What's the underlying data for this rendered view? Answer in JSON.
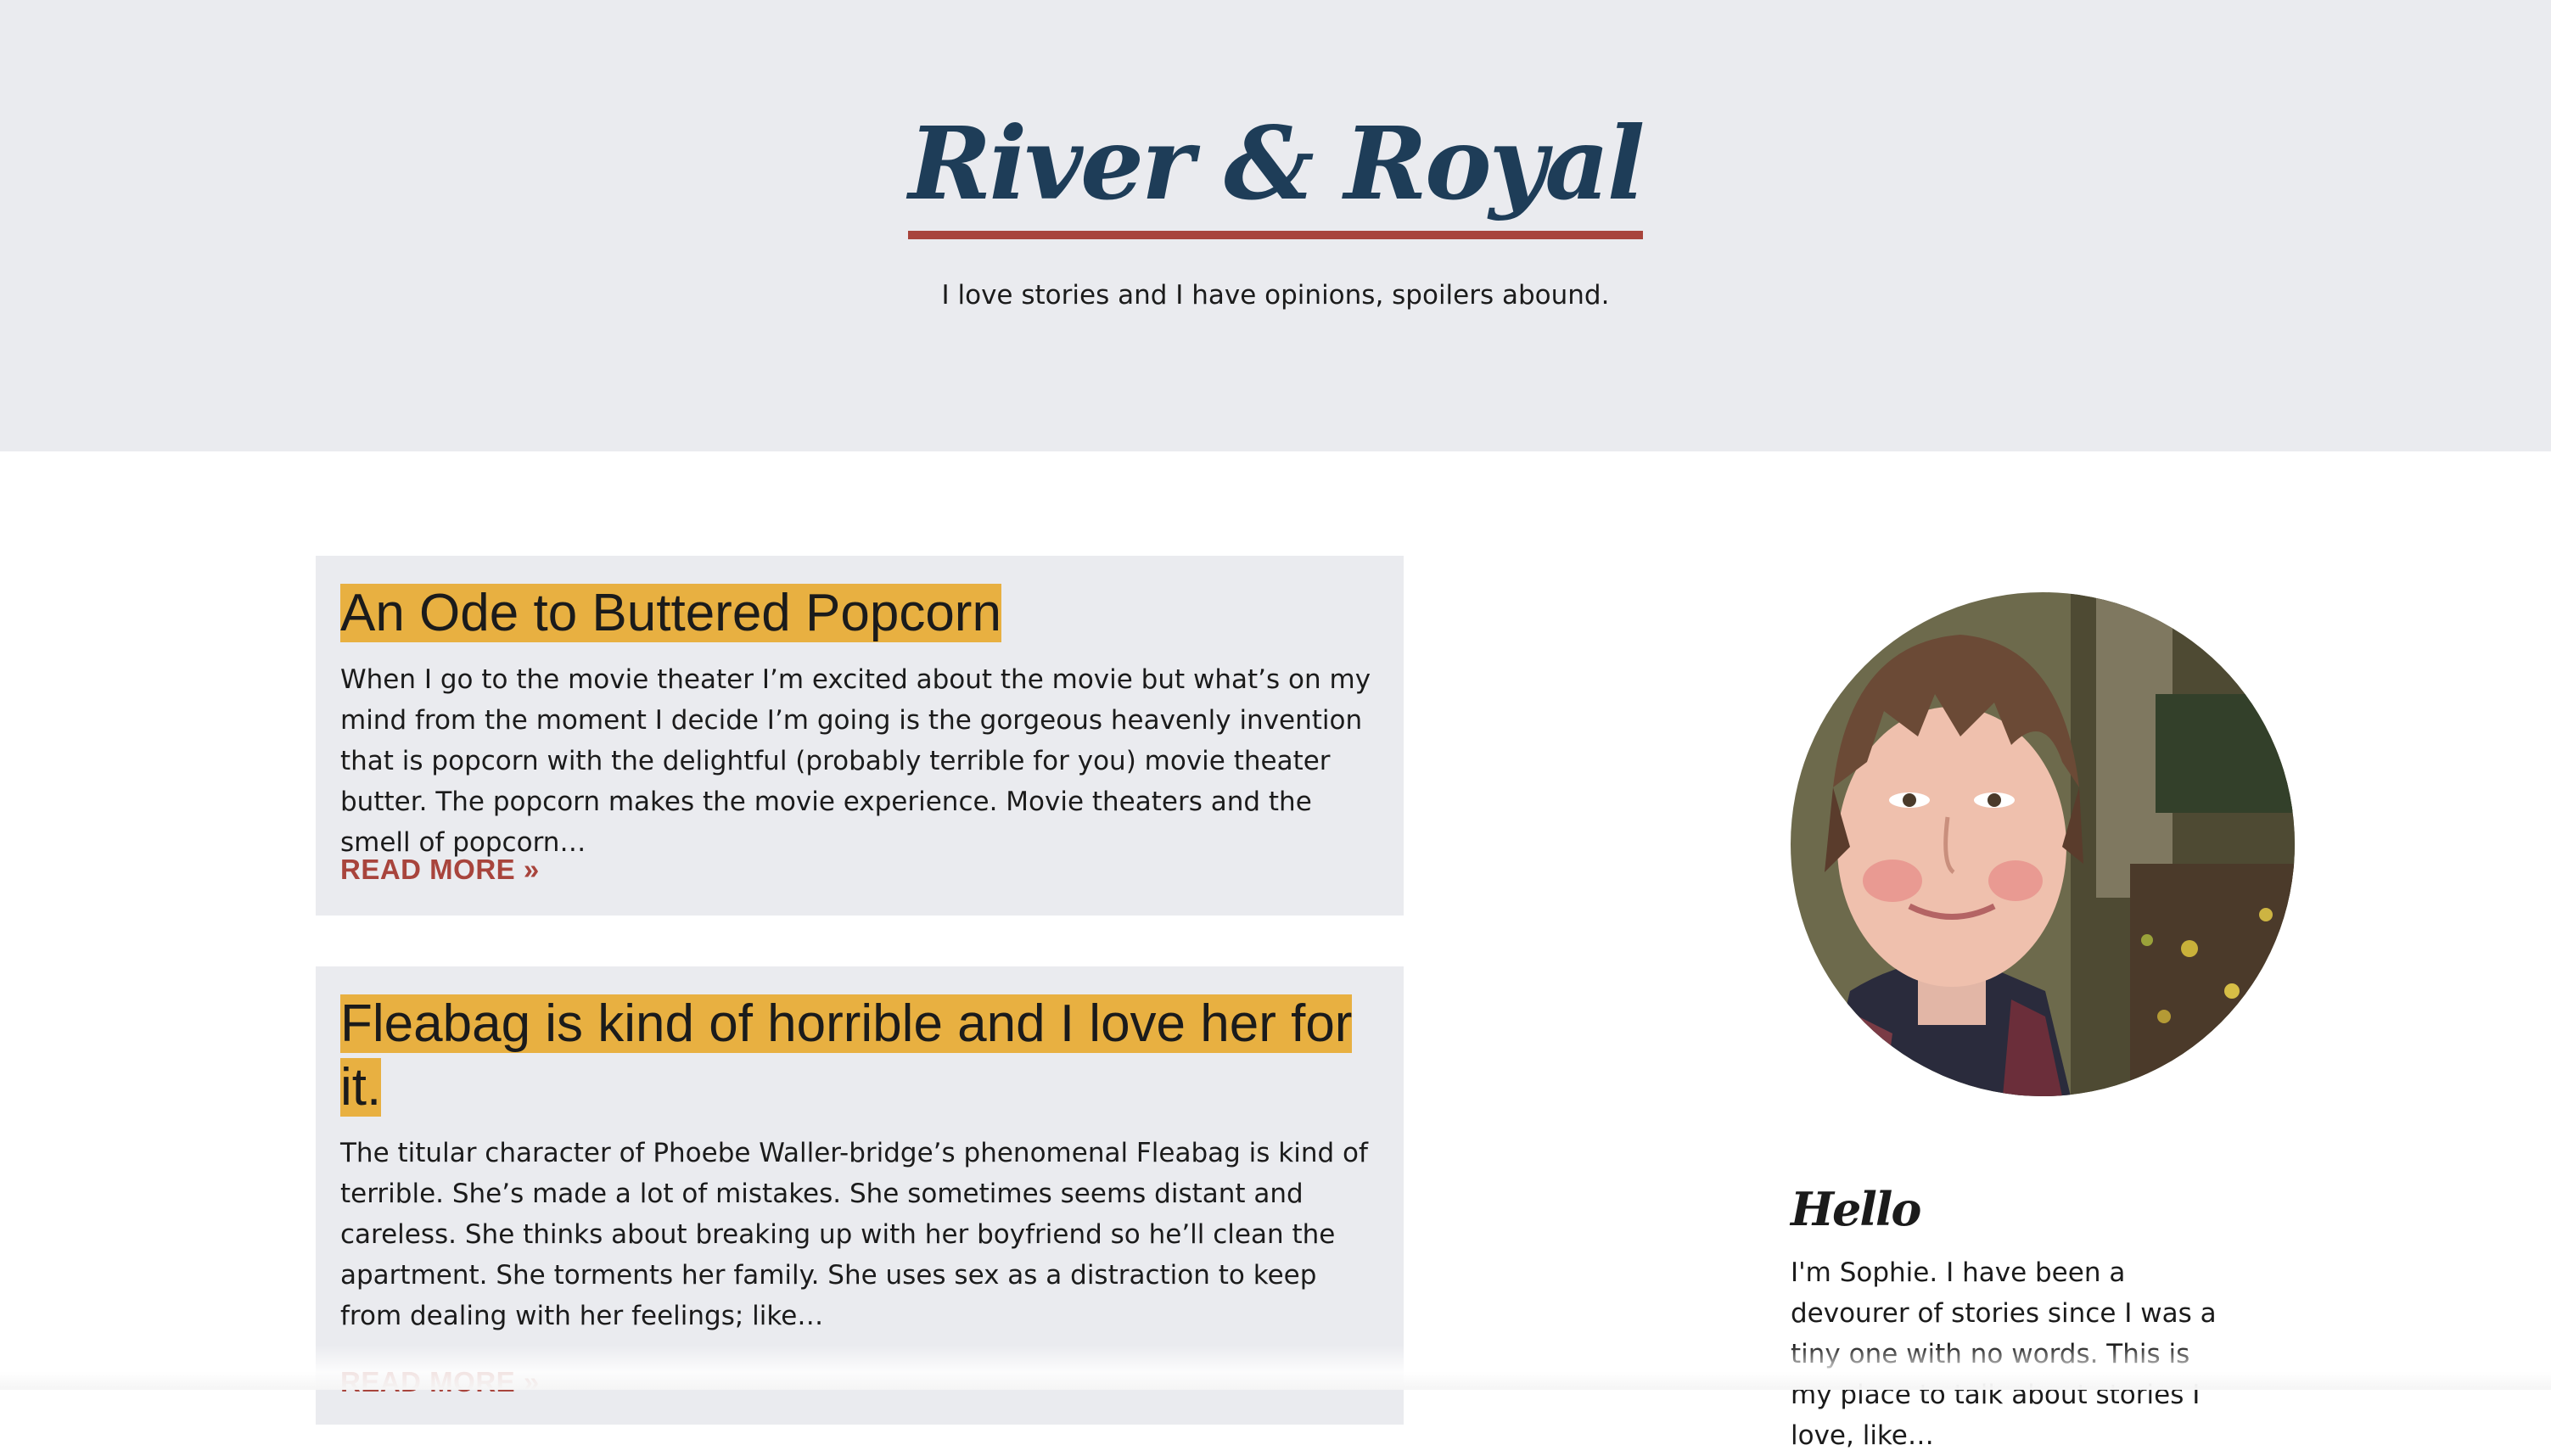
{
  "header": {
    "site_title": "River & Royal",
    "tagline": "I love stories and I have opinions, spoilers abound."
  },
  "posts": [
    {
      "title": "An Ode to Buttered Popcorn",
      "excerpt": "When I go to the movie theater I’m excited about the movie but what’s on my mind from the moment I decide I’m going is the gorgeous heavenly invention that is popcorn with the delightful (probably terrible for you) movie theater butter. The popcorn makes the movie experience. Movie theaters and the smell of popcorn…",
      "read_more": "READ MORE »"
    },
    {
      "title": "Fleabag is kind of horrible and I love her for it.",
      "excerpt": "The titular character of Phoebe Waller-bridge’s phenomenal Fleabag is kind of terrible. She’s made a lot of mistakes. She sometimes seems distant and careless. She thinks about breaking up with her boyfriend so he’ll clean the apartment. She torments her family. She uses sex as a distraction to keep from dealing with her feelings; like…",
      "read_more": "READ MORE »"
    }
  ],
  "sidebar": {
    "heading": "Hello",
    "bio": "I'm Sophie. I have been a devourer of stories since I was a tiny one with no words. This is my place to talk about stories I love, like…"
  },
  "colors": {
    "title_navy": "#1e3d58",
    "accent_red": "#a8443c",
    "highlight_gold": "#e8b041",
    "panel_gray": "#eaebef"
  }
}
